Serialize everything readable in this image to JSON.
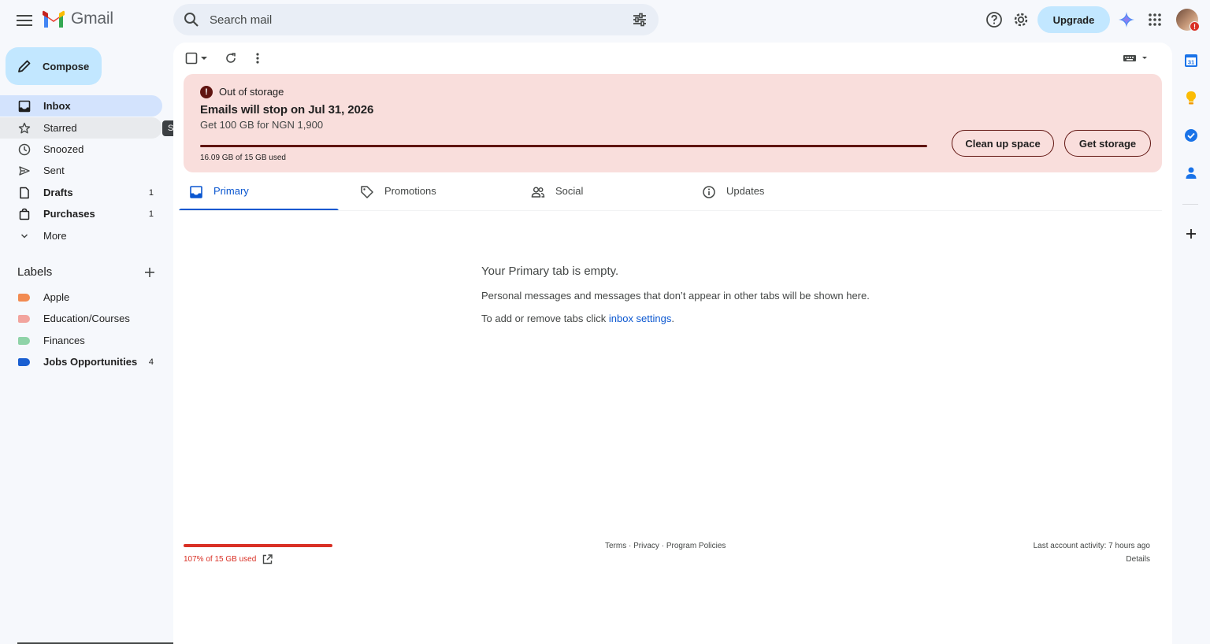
{
  "app": {
    "name": "Gmail"
  },
  "search": {
    "placeholder": "Search mail"
  },
  "header": {
    "upgrade_label": "Upgrade",
    "avatar_badge": "!"
  },
  "compose": {
    "label": "Compose"
  },
  "nav": {
    "inbox": {
      "label": "Inbox"
    },
    "starred": {
      "label": "Starred"
    },
    "snoozed": {
      "label": "Snoozed"
    },
    "sent": {
      "label": "Sent"
    },
    "drafts": {
      "label": "Drafts",
      "count": "1"
    },
    "purchases": {
      "label": "Purchases",
      "count": "1"
    },
    "more": {
      "label": "More"
    }
  },
  "tooltip": {
    "text": "Starred"
  },
  "labels": {
    "title": "Labels",
    "items": [
      {
        "name": "Apple",
        "color": "#f28b52",
        "count": ""
      },
      {
        "name": "Education/Courses",
        "color": "#f2a49e",
        "count": ""
      },
      {
        "name": "Finances",
        "color": "#8fd3a8",
        "count": ""
      },
      {
        "name": "Jobs Opportunities",
        "color": "#1a5fd1",
        "count": "4"
      }
    ]
  },
  "banner": {
    "title": "Out of storage",
    "warning_symbol": "!",
    "headline": "Emails will stop on Jul 31, 2026",
    "subtext": "Get 100 GB for NGN 1,900",
    "usage": "16.09 GB of 15 GB used",
    "usage_fraction": 1.0,
    "clean_up_label": "Clean up space",
    "get_storage_label": "Get storage",
    "accent_color": "#601410",
    "background_color": "#f9dedc"
  },
  "tabs": [
    {
      "label": "Primary",
      "icon": "inbox-icon",
      "active": true
    },
    {
      "label": "Promotions",
      "icon": "tag-icon",
      "active": false
    },
    {
      "label": "Social",
      "icon": "people-icon",
      "active": false
    },
    {
      "label": "Updates",
      "icon": "info-icon",
      "active": false
    }
  ],
  "empty_state": {
    "title": "Your Primary tab is empty.",
    "description": "Personal messages and messages that don’t appear in other tabs will be shown here.",
    "hint_prefix": "To add or remove tabs click ",
    "hint_link": "inbox settings",
    "hint_suffix": "."
  },
  "footer": {
    "storage_used": "107% of 15 GB used",
    "storage_fraction": 1.0,
    "terms": "Terms",
    "privacy": "Privacy",
    "program_policies": "Program Policies",
    "separator": " · ",
    "last_activity": "Last account activity: 7 hours ago",
    "details": "Details"
  },
  "side_apps": {
    "calendar_day": "31"
  },
  "colors": {
    "accent_blue": "#0b57d0",
    "compose_bg": "#c2e7ff",
    "active_nav_bg": "#d3e3fd",
    "error_red": "#d93025"
  }
}
